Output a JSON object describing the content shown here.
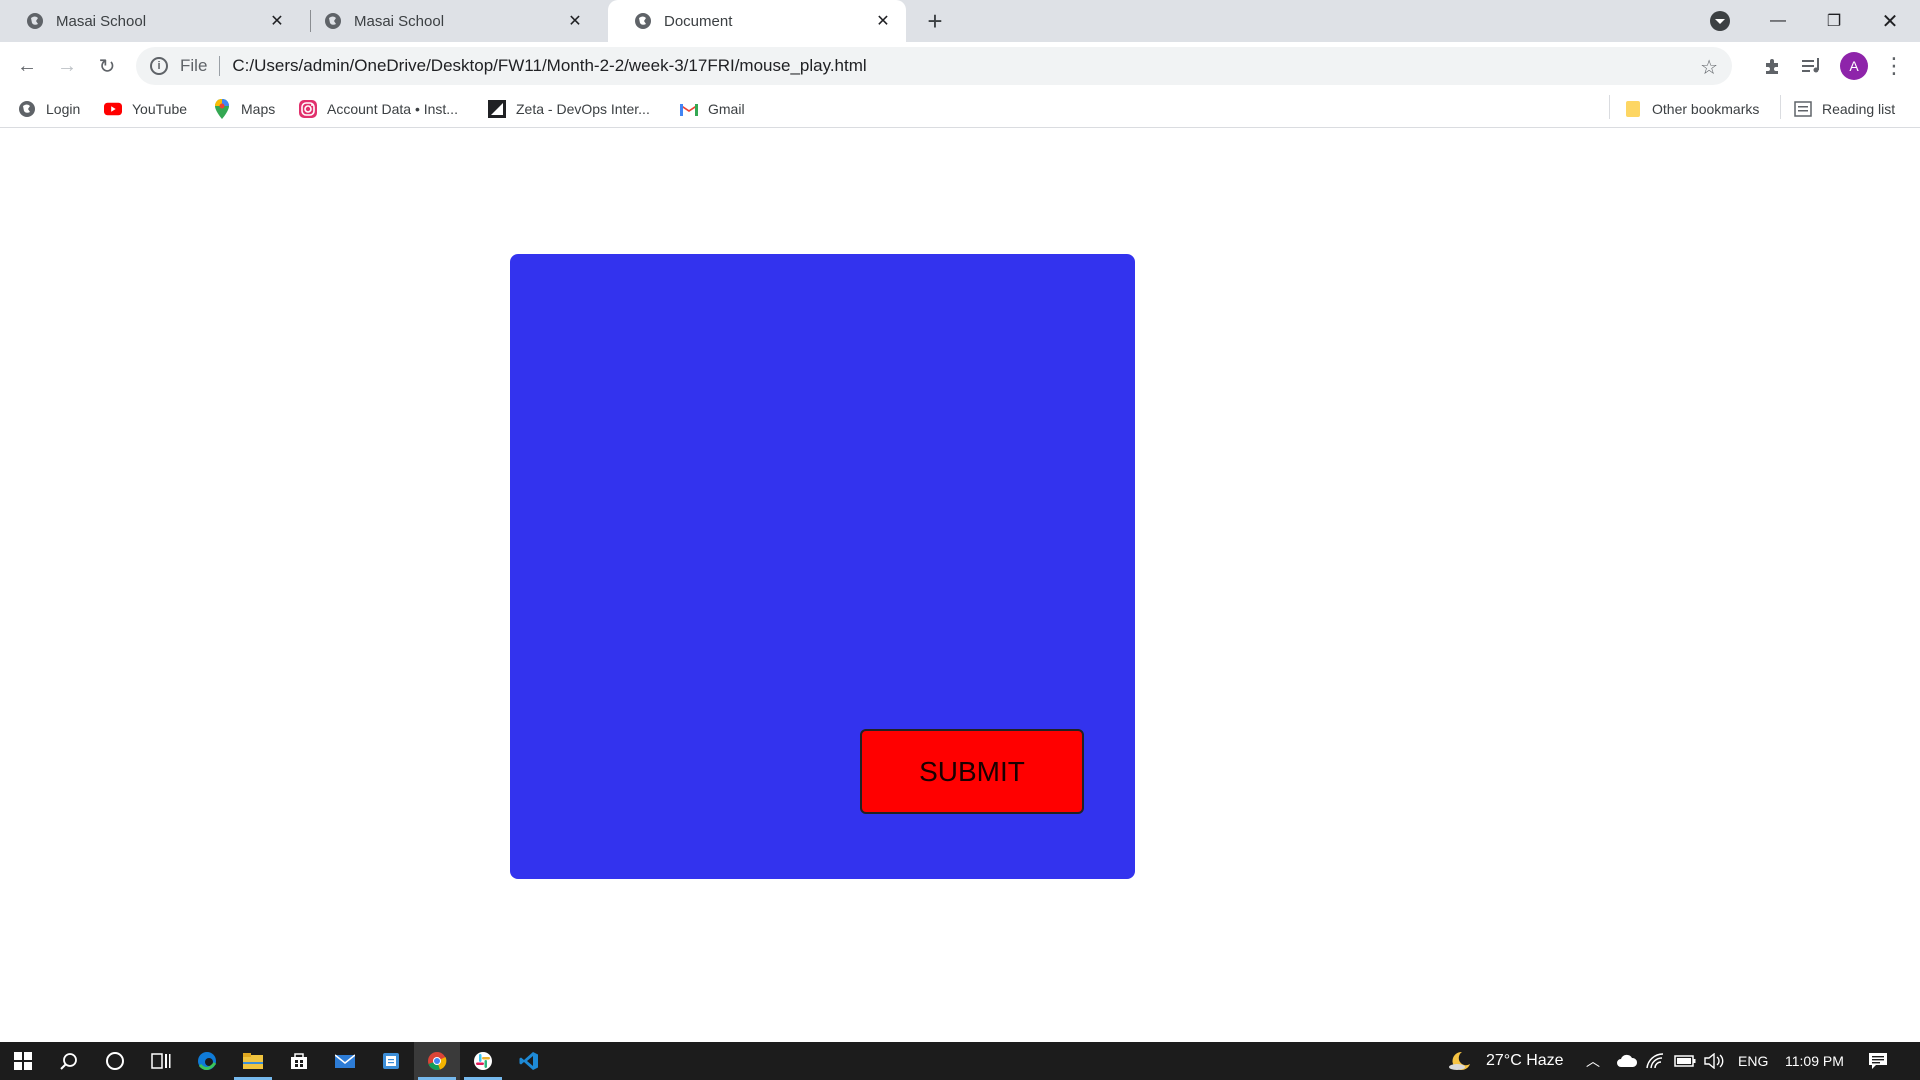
{
  "tabs": [
    {
      "title": "Masai School"
    },
    {
      "title": "Masai School"
    },
    {
      "title": "Document"
    }
  ],
  "toolbar": {
    "scheme_label": "File",
    "url": "C:/Users/admin/OneDrive/Desktop/FW11/Month-2-2/week-3/17FRI/mouse_play.html",
    "avatar_letter": "A"
  },
  "bookmarks": {
    "items": [
      {
        "label": "Login"
      },
      {
        "label": "YouTube"
      },
      {
        "label": "Maps"
      },
      {
        "label": "Account Data • Inst..."
      },
      {
        "label": "Zeta - DevOps Inter..."
      },
      {
        "label": "Gmail"
      }
    ],
    "other": "Other bookmarks",
    "reading_list": "Reading list"
  },
  "page": {
    "submit_label": "SUBMIT",
    "box_color": "#3333ee",
    "button_color": "#ff0000"
  },
  "taskbar": {
    "weather": "27°C  Haze",
    "language": "ENG",
    "time": "11:09 PM"
  }
}
